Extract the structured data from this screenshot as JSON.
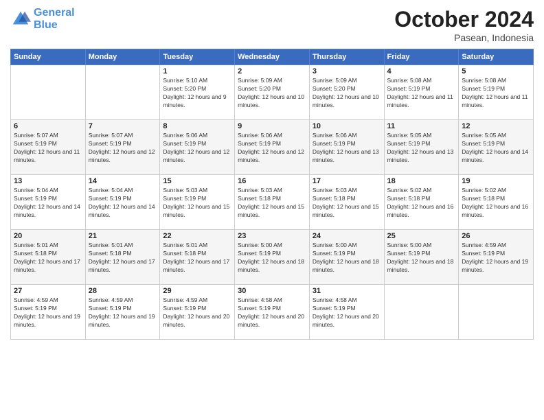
{
  "header": {
    "logo_line1": "General",
    "logo_line2": "Blue",
    "month": "October 2024",
    "location": "Pasean, Indonesia"
  },
  "weekdays": [
    "Sunday",
    "Monday",
    "Tuesday",
    "Wednesday",
    "Thursday",
    "Friday",
    "Saturday"
  ],
  "weeks": [
    [
      {
        "day": "",
        "info": ""
      },
      {
        "day": "",
        "info": ""
      },
      {
        "day": "1",
        "info": "Sunrise: 5:10 AM\nSunset: 5:20 PM\nDaylight: 12 hours and 9 minutes."
      },
      {
        "day": "2",
        "info": "Sunrise: 5:09 AM\nSunset: 5:20 PM\nDaylight: 12 hours and 10 minutes."
      },
      {
        "day": "3",
        "info": "Sunrise: 5:09 AM\nSunset: 5:20 PM\nDaylight: 12 hours and 10 minutes."
      },
      {
        "day": "4",
        "info": "Sunrise: 5:08 AM\nSunset: 5:19 PM\nDaylight: 12 hours and 11 minutes."
      },
      {
        "day": "5",
        "info": "Sunrise: 5:08 AM\nSunset: 5:19 PM\nDaylight: 12 hours and 11 minutes."
      }
    ],
    [
      {
        "day": "6",
        "info": "Sunrise: 5:07 AM\nSunset: 5:19 PM\nDaylight: 12 hours and 11 minutes."
      },
      {
        "day": "7",
        "info": "Sunrise: 5:07 AM\nSunset: 5:19 PM\nDaylight: 12 hours and 12 minutes."
      },
      {
        "day": "8",
        "info": "Sunrise: 5:06 AM\nSunset: 5:19 PM\nDaylight: 12 hours and 12 minutes."
      },
      {
        "day": "9",
        "info": "Sunrise: 5:06 AM\nSunset: 5:19 PM\nDaylight: 12 hours and 12 minutes."
      },
      {
        "day": "10",
        "info": "Sunrise: 5:06 AM\nSunset: 5:19 PM\nDaylight: 12 hours and 13 minutes."
      },
      {
        "day": "11",
        "info": "Sunrise: 5:05 AM\nSunset: 5:19 PM\nDaylight: 12 hours and 13 minutes."
      },
      {
        "day": "12",
        "info": "Sunrise: 5:05 AM\nSunset: 5:19 PM\nDaylight: 12 hours and 14 minutes."
      }
    ],
    [
      {
        "day": "13",
        "info": "Sunrise: 5:04 AM\nSunset: 5:19 PM\nDaylight: 12 hours and 14 minutes."
      },
      {
        "day": "14",
        "info": "Sunrise: 5:04 AM\nSunset: 5:19 PM\nDaylight: 12 hours and 14 minutes."
      },
      {
        "day": "15",
        "info": "Sunrise: 5:03 AM\nSunset: 5:19 PM\nDaylight: 12 hours and 15 minutes."
      },
      {
        "day": "16",
        "info": "Sunrise: 5:03 AM\nSunset: 5:18 PM\nDaylight: 12 hours and 15 minutes."
      },
      {
        "day": "17",
        "info": "Sunrise: 5:03 AM\nSunset: 5:18 PM\nDaylight: 12 hours and 15 minutes."
      },
      {
        "day": "18",
        "info": "Sunrise: 5:02 AM\nSunset: 5:18 PM\nDaylight: 12 hours and 16 minutes."
      },
      {
        "day": "19",
        "info": "Sunrise: 5:02 AM\nSunset: 5:18 PM\nDaylight: 12 hours and 16 minutes."
      }
    ],
    [
      {
        "day": "20",
        "info": "Sunrise: 5:01 AM\nSunset: 5:18 PM\nDaylight: 12 hours and 17 minutes."
      },
      {
        "day": "21",
        "info": "Sunrise: 5:01 AM\nSunset: 5:18 PM\nDaylight: 12 hours and 17 minutes."
      },
      {
        "day": "22",
        "info": "Sunrise: 5:01 AM\nSunset: 5:18 PM\nDaylight: 12 hours and 17 minutes."
      },
      {
        "day": "23",
        "info": "Sunrise: 5:00 AM\nSunset: 5:19 PM\nDaylight: 12 hours and 18 minutes."
      },
      {
        "day": "24",
        "info": "Sunrise: 5:00 AM\nSunset: 5:19 PM\nDaylight: 12 hours and 18 minutes."
      },
      {
        "day": "25",
        "info": "Sunrise: 5:00 AM\nSunset: 5:19 PM\nDaylight: 12 hours and 18 minutes."
      },
      {
        "day": "26",
        "info": "Sunrise: 4:59 AM\nSunset: 5:19 PM\nDaylight: 12 hours and 19 minutes."
      }
    ],
    [
      {
        "day": "27",
        "info": "Sunrise: 4:59 AM\nSunset: 5:19 PM\nDaylight: 12 hours and 19 minutes."
      },
      {
        "day": "28",
        "info": "Sunrise: 4:59 AM\nSunset: 5:19 PM\nDaylight: 12 hours and 19 minutes."
      },
      {
        "day": "29",
        "info": "Sunrise: 4:59 AM\nSunset: 5:19 PM\nDaylight: 12 hours and 20 minutes."
      },
      {
        "day": "30",
        "info": "Sunrise: 4:58 AM\nSunset: 5:19 PM\nDaylight: 12 hours and 20 minutes."
      },
      {
        "day": "31",
        "info": "Sunrise: 4:58 AM\nSunset: 5:19 PM\nDaylight: 12 hours and 20 minutes."
      },
      {
        "day": "",
        "info": ""
      },
      {
        "day": "",
        "info": ""
      }
    ]
  ]
}
